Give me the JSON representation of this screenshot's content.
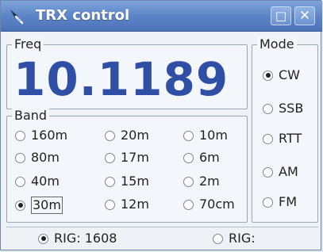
{
  "window": {
    "title": "TRX control",
    "controls": {
      "maximize": "□",
      "close": "✕"
    }
  },
  "freq": {
    "label": "Freq",
    "value": "10.1189"
  },
  "band": {
    "label": "Band",
    "options": [
      "160m",
      "20m",
      "10m",
      "80m",
      "17m",
      "6m",
      "40m",
      "15m",
      "2m",
      "30m",
      "12m",
      "70cm"
    ],
    "selected": "30m"
  },
  "mode": {
    "label": "Mode",
    "options": [
      "CW",
      "SSB",
      "RTT",
      "AM",
      "FM"
    ],
    "selected": "CW"
  },
  "rigs": [
    {
      "label": "RIG: 1608",
      "selected": true
    },
    {
      "label": "RIG:",
      "selected": false
    }
  ],
  "colors": {
    "titlebar": "#5a83c6",
    "freq_text": "#2f4fa6",
    "background": "#eef2f7"
  },
  "icons": {
    "app": "antenna-icon"
  }
}
